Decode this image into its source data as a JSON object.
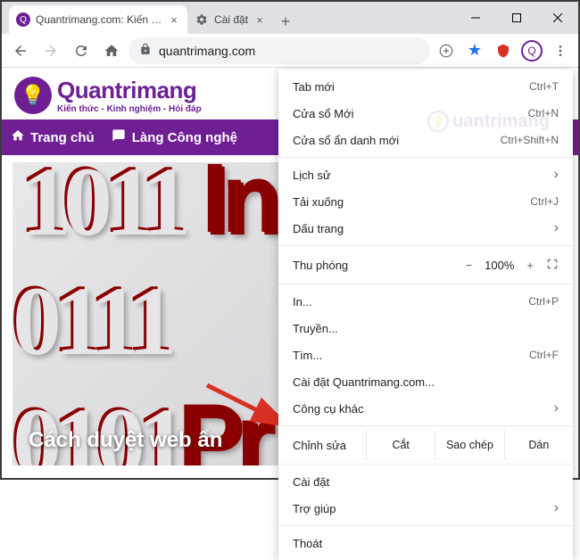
{
  "titlebar": {
    "tabs": [
      {
        "title": "Quantrimang.com: Kiến Th",
        "favicon": "Q",
        "active": true
      },
      {
        "title": "Cài đặt",
        "favicon": "gear",
        "active": false
      }
    ]
  },
  "toolbar": {
    "url": "quantrimang.com"
  },
  "site": {
    "logo_name": "Quantrimang",
    "logo_tagline": "Kiến thức - Kinh nghiệm - Hỏi đáp",
    "nav": [
      {
        "icon": "home",
        "label": "Trang chủ"
      },
      {
        "icon": "chat",
        "label": "Làng Công nghệ"
      }
    ],
    "hero_caption": "Cách duyệt web ẩn"
  },
  "menu": {
    "items_top": [
      {
        "label": "Tab mới",
        "shortcut": "Ctrl+T"
      },
      {
        "label": "Cửa sổ Mới",
        "shortcut": "Ctrl+N"
      },
      {
        "label": "Cửa sổ ẩn danh mới",
        "shortcut": "Ctrl+Shift+N"
      }
    ],
    "items_history": [
      {
        "label": "Lịch sử",
        "submenu": true
      },
      {
        "label": "Tải xuống",
        "shortcut": "Ctrl+J"
      },
      {
        "label": "Dấu trang",
        "submenu": true
      }
    ],
    "zoom": {
      "label": "Thu phóng",
      "minus": "−",
      "value": "100%",
      "plus": "+"
    },
    "items_print": [
      {
        "label": "In...",
        "shortcut": "Ctrl+P"
      },
      {
        "label": "Truyền..."
      },
      {
        "label": "Tìm...",
        "shortcut": "Ctrl+F"
      },
      {
        "label": "Cài đặt Quantrimang.com..."
      },
      {
        "label": "Công cụ khác",
        "submenu": true
      }
    ],
    "edit": {
      "label": "Chỉnh sửa",
      "cut": "Cắt",
      "copy": "Sao chép",
      "paste": "Dán"
    },
    "items_bottom": [
      {
        "label": "Cài đặt"
      },
      {
        "label": "Trợ giúp",
        "submenu": true
      }
    ],
    "exit": {
      "label": "Thoát"
    }
  },
  "watermark": "uantrimang"
}
